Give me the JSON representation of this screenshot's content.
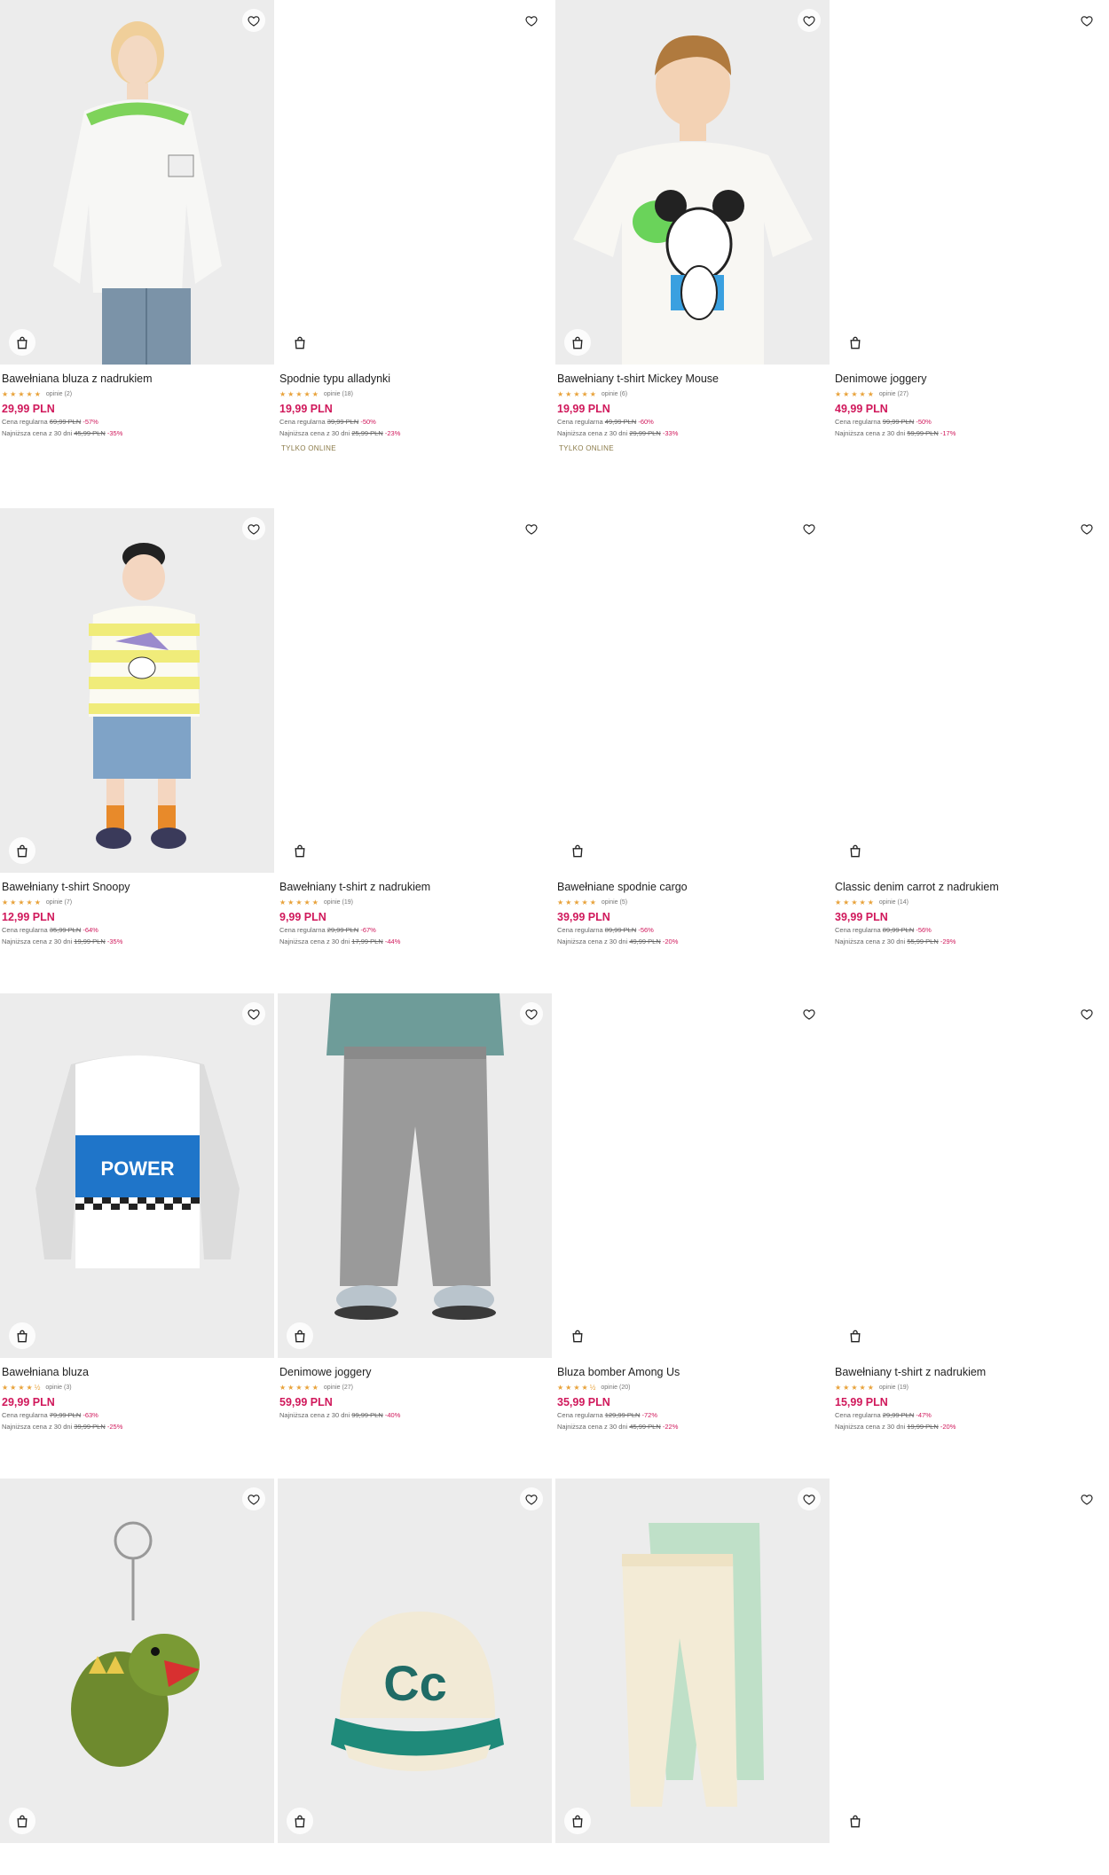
{
  "products": [
    {
      "title": "Bawełniana bluza z nadrukiem",
      "stars": "★★★★★",
      "reviews": "opinie (2)",
      "price": "29,99 PLN",
      "regular_label": "Cena regularna",
      "regular_price": "69,99 PLN",
      "regular_disc": "-57%",
      "lowest_label": "Najniższa cena z 30 dni",
      "lowest_price": "45,99 PLN",
      "lowest_disc": "-35%",
      "badge": ""
    },
    {
      "title": "Spodnie typu alladynki",
      "stars": "★★★★★",
      "reviews": "opinie (18)",
      "price": "19,99 PLN",
      "regular_label": "Cena regularna",
      "regular_price": "39,99 PLN",
      "regular_disc": "-50%",
      "lowest_label": "Najniższa cena z 30 dni",
      "lowest_price": "25,99 PLN",
      "lowest_disc": "-23%",
      "badge": "TYLKO ONLINE"
    },
    {
      "title": "Bawełniany t-shirt Mickey Mouse",
      "stars": "★★★★★",
      "reviews": "opinie (6)",
      "price": "19,99 PLN",
      "regular_label": "Cena regularna",
      "regular_price": "49,99 PLN",
      "regular_disc": "-60%",
      "lowest_label": "Najniższa cena z 30 dni",
      "lowest_price": "29,99 PLN",
      "lowest_disc": "-33%",
      "badge": "TYLKO ONLINE"
    },
    {
      "title": "Denimowe joggery",
      "stars": "★★★★★",
      "reviews": "opinie (27)",
      "price": "49,99 PLN",
      "regular_label": "Cena regularna",
      "regular_price": "99,99 PLN",
      "regular_disc": "-50%",
      "lowest_label": "Najniższa cena z 30 dni",
      "lowest_price": "59,99 PLN",
      "lowest_disc": "-17%",
      "badge": ""
    },
    {
      "title": "Bawełniany t-shirt Snoopy",
      "stars": "★★★★★",
      "reviews": "opinie (7)",
      "price": "12,99 PLN",
      "regular_label": "Cena regularna",
      "regular_price": "35,99 PLN",
      "regular_disc": "-64%",
      "lowest_label": "Najniższa cena z 30 dni",
      "lowest_price": "19,99 PLN",
      "lowest_disc": "-35%",
      "badge": ""
    },
    {
      "title": "Bawełniany t-shirt z nadrukiem",
      "stars": "★★★★★",
      "reviews": "opinie (19)",
      "price": "9,99 PLN",
      "regular_label": "Cena regularna",
      "regular_price": "29,99 PLN",
      "regular_disc": "-67%",
      "lowest_label": "Najniższa cena z 30 dni",
      "lowest_price": "17,99 PLN",
      "lowest_disc": "-44%",
      "badge": ""
    },
    {
      "title": "Bawełniane spodnie cargo",
      "stars": "★★★★★",
      "reviews": "opinie (5)",
      "price": "39,99 PLN",
      "regular_label": "Cena regularna",
      "regular_price": "89,99 PLN",
      "regular_disc": "-56%",
      "lowest_label": "Najniższa cena z 30 dni",
      "lowest_price": "49,99 PLN",
      "lowest_disc": "-20%",
      "badge": ""
    },
    {
      "title": "Classic denim carrot z nadrukiem",
      "stars": "★★★★★",
      "reviews": "opinie (14)",
      "price": "39,99 PLN",
      "regular_label": "Cena regularna",
      "regular_price": "89,99 PLN",
      "regular_disc": "-56%",
      "lowest_label": "Najniższa cena z 30 dni",
      "lowest_price": "55,99 PLN",
      "lowest_disc": "-29%",
      "badge": ""
    },
    {
      "title": "Bawełniana bluza",
      "stars": "★★★★½",
      "reviews": "opinie (3)",
      "price": "29,99 PLN",
      "regular_label": "Cena regularna",
      "regular_price": "79,99 PLN",
      "regular_disc": "-63%",
      "lowest_label": "Najniższa cena z 30 dni",
      "lowest_price": "39,99 PLN",
      "lowest_disc": "-25%",
      "badge": ""
    },
    {
      "title": "Denimowe joggery",
      "stars": "★★★★★",
      "reviews": "opinie (27)",
      "price": "59,99 PLN",
      "regular_label": "",
      "regular_price": "",
      "regular_disc": "",
      "lowest_label": "Najniższa cena z 30 dni",
      "lowest_price": "99,99 PLN",
      "lowest_disc": "-40%",
      "badge": ""
    },
    {
      "title": "Bluza bomber Among Us",
      "stars": "★★★★½",
      "reviews": "opinie (20)",
      "price": "35,99 PLN",
      "regular_label": "Cena regularna",
      "regular_price": "129,99 PLN",
      "regular_disc": "-72%",
      "lowest_label": "Najniższa cena z 30 dni",
      "lowest_price": "45,99 PLN",
      "lowest_disc": "-22%",
      "badge": ""
    },
    {
      "title": "Bawełniany t-shirt z nadrukiem",
      "stars": "★★★★★",
      "reviews": "opinie (19)",
      "price": "15,99 PLN",
      "regular_label": "Cena regularna",
      "regular_price": "29,99 PLN",
      "regular_disc": "-47%",
      "lowest_label": "Najniższa cena z 30 dni",
      "lowest_price": "19,99 PLN",
      "lowest_disc": "-20%",
      "badge": ""
    },
    {
      "title": "",
      "stars": "",
      "reviews": "",
      "price": "",
      "regular_label": "",
      "regular_price": "",
      "regular_disc": "",
      "lowest_label": "",
      "lowest_price": "",
      "lowest_disc": "",
      "badge": ""
    },
    {
      "title": "",
      "stars": "",
      "reviews": "",
      "price": "",
      "regular_label": "",
      "regular_price": "",
      "regular_disc": "",
      "lowest_label": "",
      "lowest_price": "",
      "lowest_disc": "",
      "badge": ""
    },
    {
      "title": "",
      "stars": "",
      "reviews": "",
      "price": "",
      "regular_label": "",
      "regular_price": "",
      "regular_disc": "",
      "lowest_label": "",
      "lowest_price": "",
      "lowest_disc": "",
      "badge": ""
    },
    {
      "title": "",
      "stars": "",
      "reviews": "",
      "price": "",
      "regular_label": "",
      "regular_price": "",
      "regular_disc": "",
      "lowest_label": "",
      "lowest_price": "",
      "lowest_disc": "",
      "badge": ""
    }
  ],
  "product_images": [
    {
      "kind": "photo",
      "subject": "girl in white sweatshirt with green print and jeans"
    },
    {
      "kind": "blank",
      "subject": ""
    },
    {
      "kind": "photo",
      "subject": "boy in white Mickey Mouse t-shirt"
    },
    {
      "kind": "blank",
      "subject": ""
    },
    {
      "kind": "photo",
      "subject": "toddler in yellow striped Snoopy t-shirt and denim shorts"
    },
    {
      "kind": "blank",
      "subject": ""
    },
    {
      "kind": "blank",
      "subject": ""
    },
    {
      "kind": "blank",
      "subject": ""
    },
    {
      "kind": "photo",
      "subject": "white and blue POWER sweatshirt with grey sleeves"
    },
    {
      "kind": "photo",
      "subject": "grey denim joggers worn with sneakers"
    },
    {
      "kind": "blank",
      "subject": ""
    },
    {
      "kind": "blank",
      "subject": ""
    },
    {
      "kind": "photo",
      "subject": "green plush dinosaur keychain"
    },
    {
      "kind": "photo",
      "subject": "cream and green cap with Cc logo"
    },
    {
      "kind": "photo",
      "subject": "two pairs of leggings, cream print and mint"
    },
    {
      "kind": "blank",
      "subject": ""
    }
  ],
  "icons": {
    "favorite": "heart-outline-icon",
    "cart": "shopping-bag-icon"
  },
  "colors": {
    "price": "#d0185b",
    "stars": "#e8a23a",
    "badge": "#8a7a48",
    "image_bg": "#ececec"
  }
}
